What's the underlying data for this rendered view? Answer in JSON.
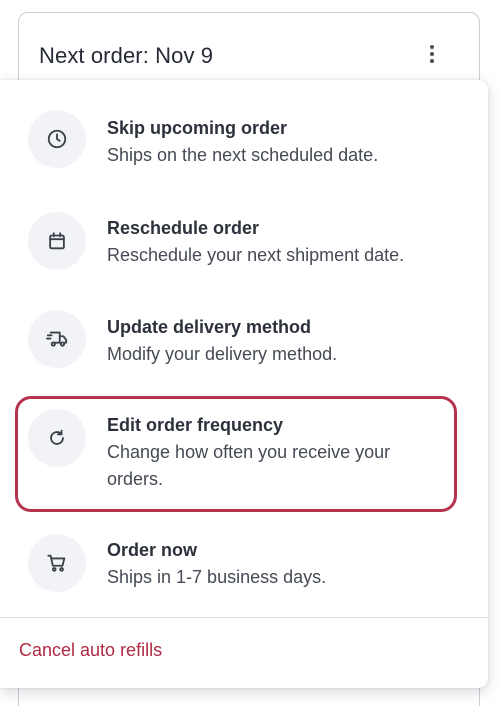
{
  "order_card": {
    "title": "Next order: Nov 9",
    "menu_icon": "more-vertical-icon"
  },
  "menu": {
    "items": [
      {
        "icon": "clock-icon",
        "title": "Skip upcoming order",
        "description": "Ships on the next scheduled date."
      },
      {
        "icon": "calendar-icon",
        "title": "Reschedule order",
        "description": "Reschedule your next shipment date."
      },
      {
        "icon": "delivery-truck-icon",
        "title": "Update delivery method",
        "description": "Modify your delivery method."
      },
      {
        "icon": "refresh-icon",
        "title": "Edit order frequency",
        "description": "Change how often you receive your orders.",
        "highlighted": true
      },
      {
        "icon": "shopping-cart-icon",
        "title": "Order now",
        "description": "Ships in 1-7 business days."
      }
    ],
    "cancel_label": "Cancel auto refills"
  },
  "colors": {
    "accent": "#b02b45",
    "highlight_border": "#b5334c",
    "icon_background": "#f1f3f6",
    "text_primary": "#2c313b",
    "card_border": "#c9ced8"
  }
}
